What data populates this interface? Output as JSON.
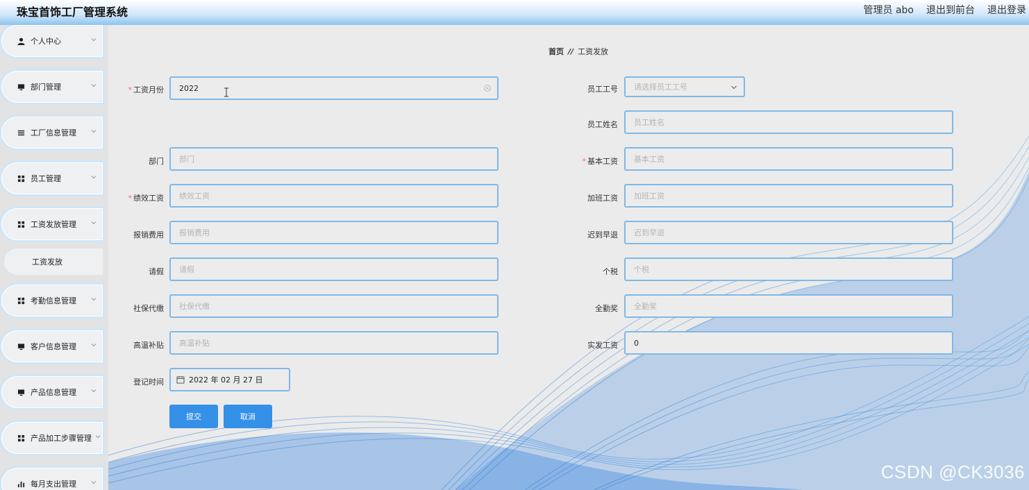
{
  "header": {
    "title": "珠宝首饰工厂管理系统",
    "admin": "管理员 abo",
    "back_to_front": "退出到前台",
    "logout": "退出登录"
  },
  "sidebar": {
    "items": [
      {
        "label": "个人中心",
        "icon": "user-icon"
      },
      {
        "label": "部门管理",
        "icon": "monitor-icon"
      },
      {
        "label": "工厂信息管理",
        "icon": "list-icon"
      },
      {
        "label": "员工管理",
        "icon": "grid-icon"
      },
      {
        "label": "工资发放管理",
        "icon": "grid-icon"
      },
      {
        "label": "考勤信息管理",
        "icon": "grid-icon"
      },
      {
        "label": "客户信息管理",
        "icon": "monitor-icon"
      },
      {
        "label": "产品信息管理",
        "icon": "monitor-icon"
      },
      {
        "label": "产品加工步骤管理",
        "icon": "grid-icon"
      },
      {
        "label": "每月支出管理",
        "icon": "bar-chart-icon"
      }
    ],
    "submenu": {
      "label": "工资发放"
    }
  },
  "breadcrumb": {
    "home": "首页",
    "separator": "//",
    "current": "工资发放"
  },
  "form": {
    "salary_month": {
      "label": "工资月份",
      "value": "2022",
      "required": true
    },
    "employee_id": {
      "label": "员工工号",
      "placeholder": "请选择员工工号"
    },
    "employee_name": {
      "label": "员工姓名",
      "placeholder": "员工姓名"
    },
    "department": {
      "label": "部门",
      "placeholder": "部门"
    },
    "base_salary": {
      "label": "基本工资",
      "placeholder": "基本工资",
      "required": true
    },
    "performance_salary": {
      "label": "绩效工资",
      "placeholder": "绩效工资",
      "required": true
    },
    "overtime_salary": {
      "label": "加班工资",
      "placeholder": "加班工资"
    },
    "reimbursement": {
      "label": "报销费用",
      "placeholder": "报销费用"
    },
    "late_early": {
      "label": "迟到早退",
      "placeholder": "迟到早退"
    },
    "leave": {
      "label": "请假",
      "placeholder": "请假"
    },
    "income_tax": {
      "label": "个税",
      "placeholder": "个税"
    },
    "social_insurance": {
      "label": "社保代缴",
      "placeholder": "社保代缴"
    },
    "attendance_bonus": {
      "label": "全勤奖",
      "placeholder": "全勤奖"
    },
    "heat_allowance": {
      "label": "高温补贴",
      "placeholder": "高温补贴"
    },
    "actual_salary": {
      "label": "实发工资",
      "value": "0"
    },
    "register_time": {
      "label": "登记时间",
      "value": "2022 年 02 月 27 日"
    },
    "submit": "提交",
    "cancel": "取消"
  },
  "watermark": "CSDN @CK3036",
  "colors": {
    "accent": "#3590e8",
    "field_border": "#7fb8e6",
    "required": "#f56c6c",
    "header_gradient_end": "#8cc4ef"
  }
}
